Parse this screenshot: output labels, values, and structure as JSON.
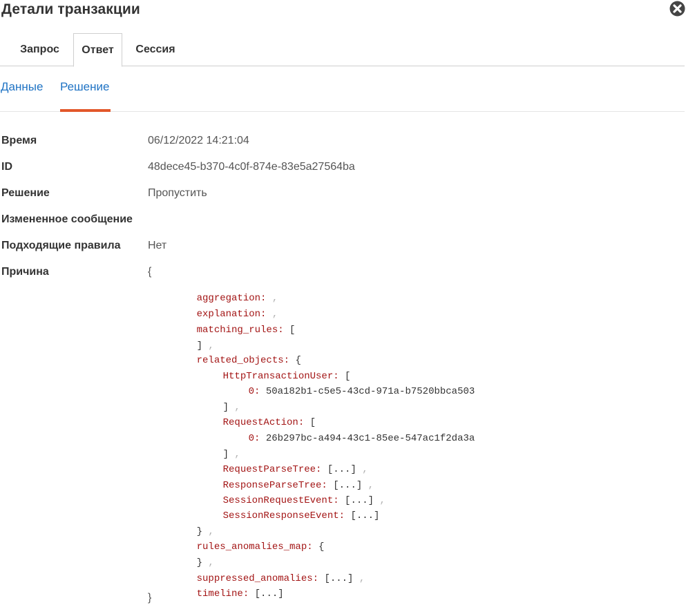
{
  "header": {
    "title": "Детали транзакции"
  },
  "tabs": [
    {
      "label": "Запрос"
    },
    {
      "label": "Ответ",
      "active": true
    },
    {
      "label": "Сессия"
    }
  ],
  "subtabs": [
    {
      "label": "Данные"
    },
    {
      "label": "Решение",
      "active": true
    }
  ],
  "details": {
    "time_label": "Время",
    "time_value": "06/12/2022 14:21:04",
    "id_label": "ID",
    "id_value": "48dece45-b370-4c0f-874e-83e5a27564ba",
    "decision_label": "Решение",
    "decision_value": "Пропустить",
    "modified_label": "Измененное сообщение",
    "rules_label": "Подходящие правила",
    "rules_value": "Нет",
    "reason_label": "Причина"
  },
  "reason": {
    "open": "{",
    "close": "}",
    "aggregation": "aggregation:",
    "explanation": "explanation:",
    "matching_rules": "matching_rules:",
    "related_objects": "related_objects:",
    "http_transaction_user": "HttpTransactionUser:",
    "http_transaction_user_0_key": "0:",
    "http_transaction_user_0_value": "50a182b1-c5e5-43cd-971a-b7520bbca503",
    "request_action": "RequestAction:",
    "request_action_0_key": "0:",
    "request_action_0_value": "26b297bc-a494-43c1-85ee-547ac1f2da3a",
    "request_parse_tree": "RequestParseTree:",
    "response_parse_tree": "ResponseParseTree:",
    "session_request_event": "SessionRequestEvent:",
    "session_response_event": "SessionResponseEvent:",
    "rules_anomalies_map": "rules_anomalies_map:",
    "suppressed_anomalies": "suppressed_anomalies:",
    "timeline": "timeline:",
    "collapsed": "[...]",
    "array_open": "[",
    "array_close": "]",
    "object_open": "{",
    "object_close": "}",
    "comma": ","
  },
  "colors": {
    "accent_underline": "#e2572a",
    "link": "#1f73c4",
    "json_key": "#a31515"
  },
  "icons": {
    "close": "close-circle-icon"
  }
}
